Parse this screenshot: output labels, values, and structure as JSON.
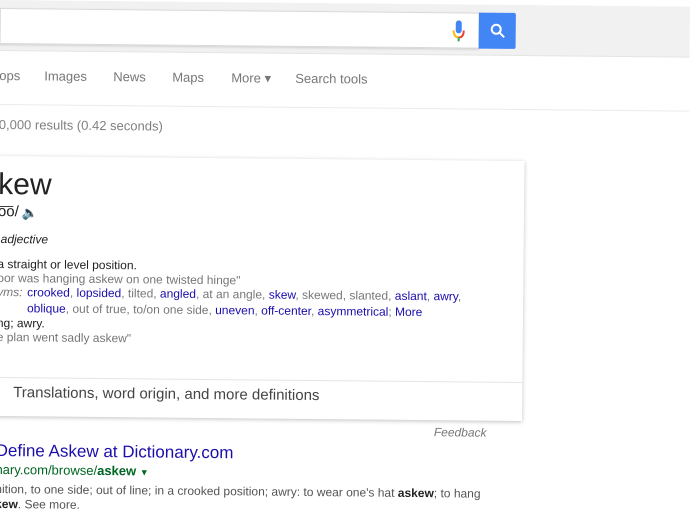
{
  "header": {
    "search_value": "",
    "mic_icon": "microphone-icon",
    "search_icon": "magnifier-icon",
    "accent": "#4285f4"
  },
  "tabs": [
    {
      "label": "ops"
    },
    {
      "label": "Images"
    },
    {
      "label": "News"
    },
    {
      "label": "Maps"
    },
    {
      "label": "More ▾"
    },
    {
      "label": "Search tools"
    }
  ],
  "stats": "0,000 results (0.42 seconds)",
  "definition": {
    "word": "kew",
    "pronunciation": "o͞o/",
    "part_of_speech": "adjective",
    "sense1": "a straight or level position.",
    "example1": "oor was hanging askew on one twisted hinge\"",
    "synonyms_label": "yms:",
    "synonyms_line1": [
      {
        "t": "crooked",
        "l": true
      },
      {
        "t": ", ",
        "l": false
      },
      {
        "t": "lopsided",
        "l": true
      },
      {
        "t": ", tilted, ",
        "l": false
      },
      {
        "t": "angled",
        "l": true
      },
      {
        "t": ", at an angle, ",
        "l": false
      },
      {
        "t": "skew",
        "l": true
      },
      {
        "t": ", skewed, slanted, ",
        "l": false
      },
      {
        "t": "aslant",
        "l": true
      },
      {
        "t": ", ",
        "l": false
      },
      {
        "t": "awry",
        "l": true
      },
      {
        "t": ",",
        "l": false
      }
    ],
    "synonyms_line2": [
      {
        "t": "oblique",
        "l": true
      },
      {
        "t": ", out of true, to/on one side, ",
        "l": false
      },
      {
        "t": "uneven",
        "l": true
      },
      {
        "t": ", ",
        "l": false
      },
      {
        "t": "off-center",
        "l": true
      },
      {
        "t": ", ",
        "l": false
      },
      {
        "t": "asymmetrical",
        "l": true
      },
      {
        "t": ";  ",
        "l": false
      },
      {
        "t": "More",
        "l": true
      }
    ],
    "sense2": "ng; awry.",
    "example2": "e plan went sadly askew\"",
    "more_link": "Translations, word origin, and more definitions"
  },
  "feedback": "Feedback",
  "result": {
    "title": "Define Askew at Dictionary.com",
    "url_prefix": "nary.com/browse/",
    "url_bold": "askew",
    "snippet1_a": "nition, to one side; out of line; in a crooked position; awry: to wear one's hat ",
    "snippet1_b": "askew",
    "snippet1_c": "; to hang",
    "snippet2_a": "kew",
    "snippet2_b": ". See more."
  }
}
